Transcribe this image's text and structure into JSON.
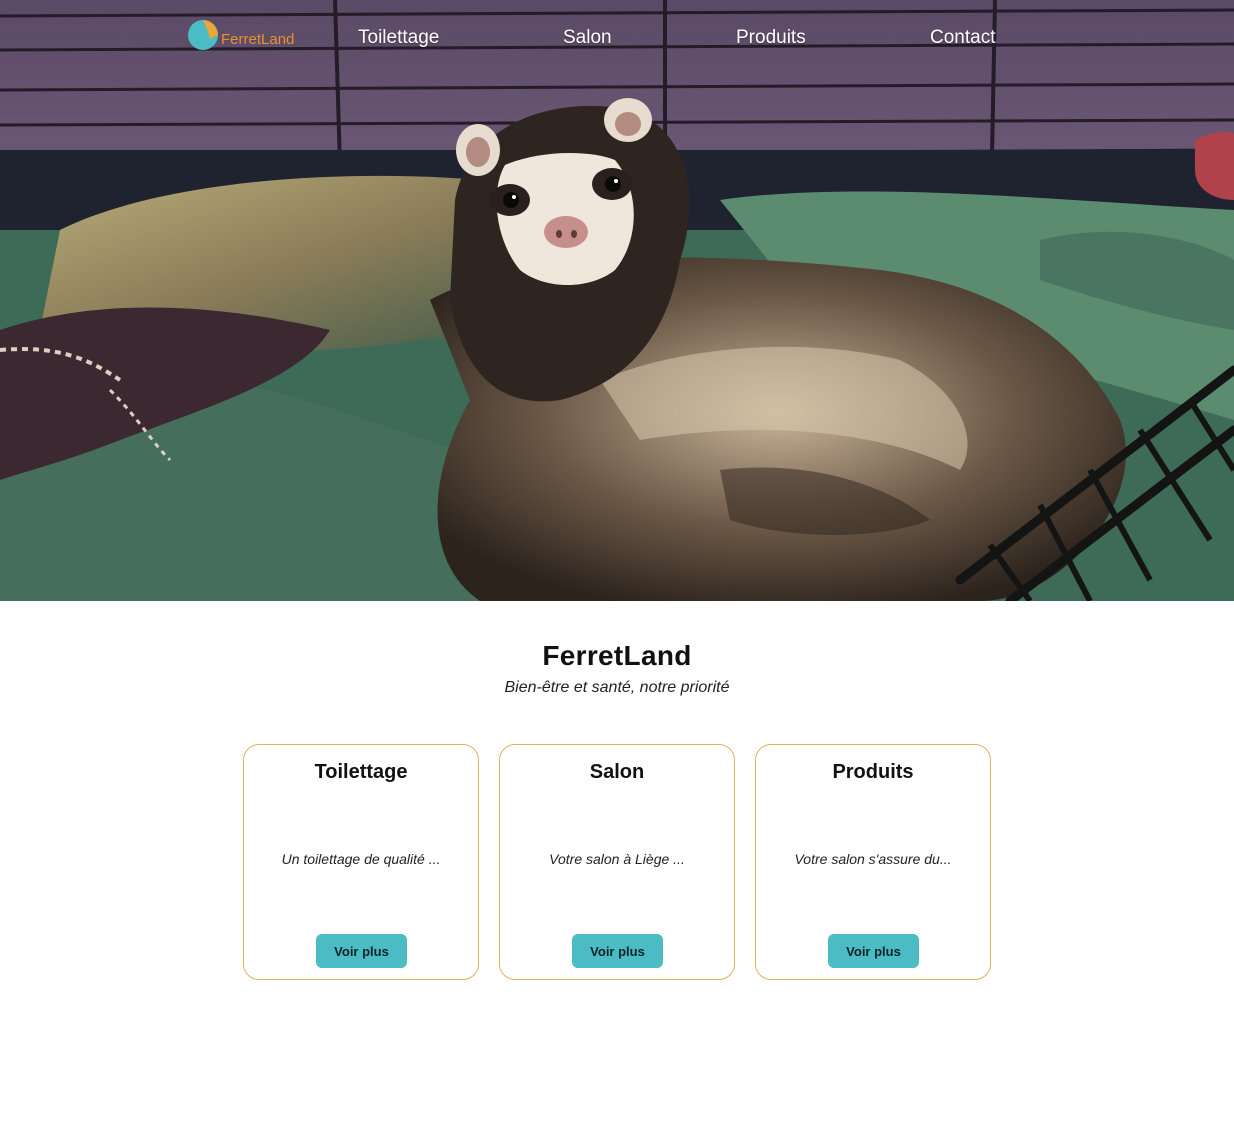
{
  "nav": {
    "logo_text": "FerretLand",
    "links": [
      "Toilettage",
      "Salon",
      "Produits",
      "Contact"
    ]
  },
  "hero": {
    "image": "ferret lying on a blanket inside a cage"
  },
  "main": {
    "title": "FerretLand",
    "tagline": "Bien-être et santé, notre priorité"
  },
  "cards": [
    {
      "title": "Toilettage",
      "text": "Un toilettage de qualité ...",
      "button": "Voir plus"
    },
    {
      "title": "Salon",
      "text": "Votre salon à Liège ...",
      "button": "Voir plus"
    },
    {
      "title": "Produits",
      "text": "Votre salon s'assure du...",
      "button": "Voir plus"
    }
  ],
  "colors": {
    "accent_button": "#4bbcc4",
    "card_border": "#e0b158",
    "logo_text": "#e8902c",
    "logo_mark_teal": "#4bbcc4",
    "logo_mark_gold": "#e8a63c"
  }
}
